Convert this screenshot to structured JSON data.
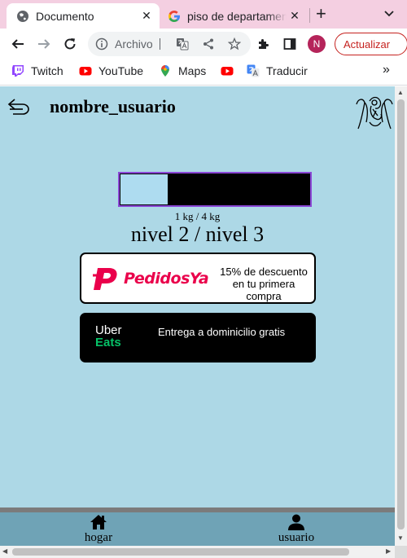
{
  "browser": {
    "tabs": [
      {
        "title": "Documento",
        "active": true,
        "icon": "globe-icon"
      },
      {
        "title": "piso de departamento",
        "active": false,
        "icon": "google-icon"
      }
    ],
    "new_tab": "+",
    "omnibox": {
      "label": "Archivo"
    },
    "profile_initial": "N",
    "update_label": "Actualizar",
    "bookmarks": [
      {
        "label": "Twitch",
        "icon": "twitch-icon"
      },
      {
        "label": "YouTube",
        "icon": "youtube-icon"
      },
      {
        "label": "Maps",
        "icon": "maps-icon"
      },
      {
        "label": "",
        "icon": "youtube-icon"
      },
      {
        "label": "Traducir",
        "icon": "translate-icon"
      }
    ],
    "bookmarks_more": "»"
  },
  "page": {
    "username": "nombre_usuario",
    "progress": {
      "text": "1 kg / 4 kg",
      "current": 1,
      "max": 4,
      "fraction": 0.25
    },
    "level_text": "nivel 2 / nivel 3",
    "promos": [
      {
        "brand": "PedidosYa",
        "description": "15% de descuento en tu primera compra",
        "brand_color": "#ea004b"
      },
      {
        "brand_line1": "Uber",
        "brand_line2": "Eats",
        "description": "Entrega a dominicilio gratis",
        "brand_color": "#06c167"
      }
    ],
    "nav": [
      {
        "label": "hogar",
        "icon": "home-icon"
      },
      {
        "label": "usuario",
        "icon": "user-icon"
      }
    ]
  },
  "colors": {
    "page_background": "#add8e6",
    "footer_background": "#6fa3b6",
    "progress_border": "#8a47d6",
    "tabbar": "#f4cfe1"
  }
}
